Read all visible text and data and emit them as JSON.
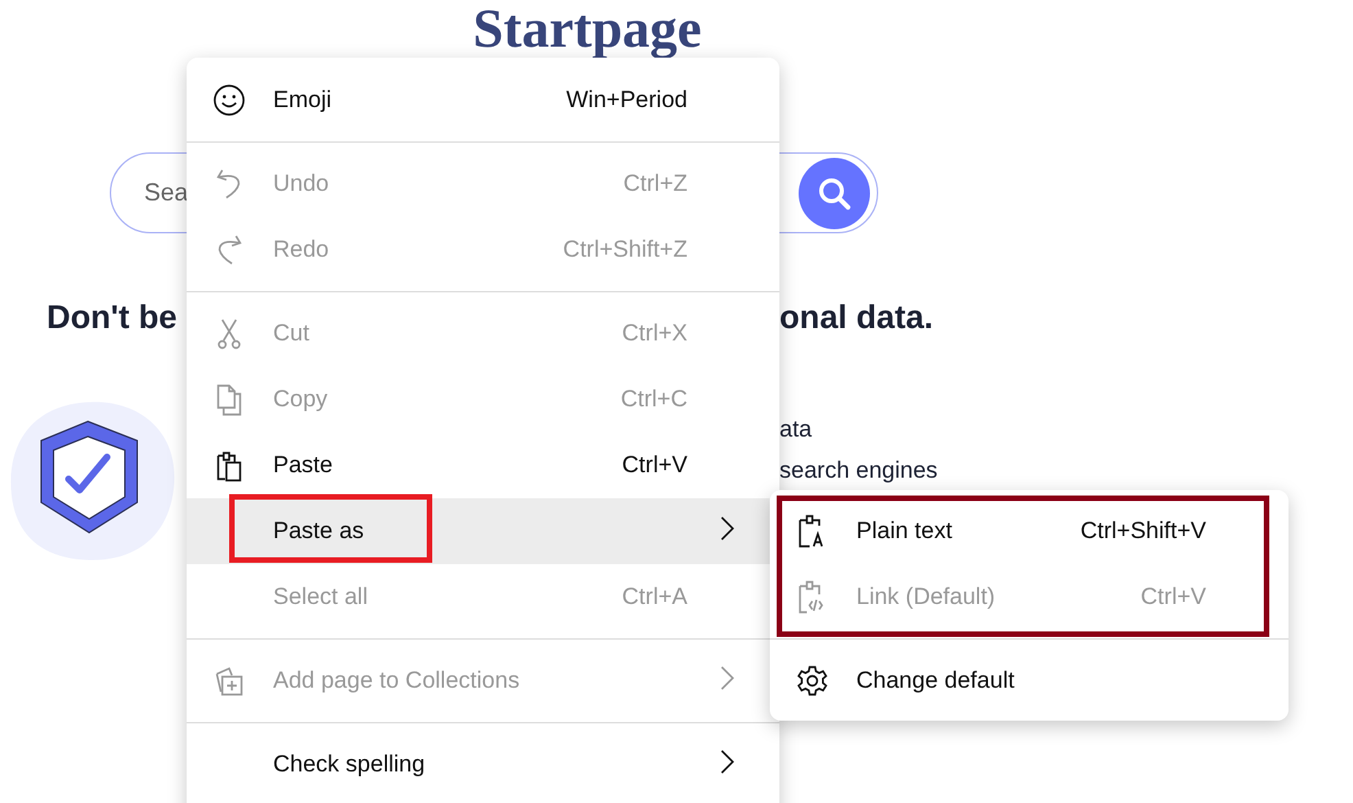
{
  "page": {
    "logo": "Startpage",
    "search": {
      "placeholder": "Sea"
    },
    "headline": [
      "Don't be",
      "onal data."
    ],
    "features": [
      "ata",
      "search engines"
    ]
  },
  "context_menu": {
    "items": [
      {
        "kind": "item",
        "label": "Emoji",
        "shortcut": "Win+Period",
        "disabled": false,
        "selected": false,
        "submenu": false
      },
      {
        "kind": "separator"
      },
      {
        "kind": "item",
        "label": "Undo",
        "shortcut": "Ctrl+Z",
        "disabled": true,
        "selected": false,
        "submenu": false
      },
      {
        "kind": "item",
        "label": "Redo",
        "shortcut": "Ctrl+Shift+Z",
        "disabled": true,
        "selected": false,
        "submenu": false
      },
      {
        "kind": "separator"
      },
      {
        "kind": "item",
        "label": "Cut",
        "shortcut": "Ctrl+X",
        "disabled": true,
        "selected": false,
        "submenu": false
      },
      {
        "kind": "item",
        "label": "Copy",
        "shortcut": "Ctrl+C",
        "disabled": true,
        "selected": false,
        "submenu": false
      },
      {
        "kind": "item",
        "label": "Paste",
        "shortcut": "Ctrl+V",
        "disabled": false,
        "selected": false,
        "submenu": false
      },
      {
        "kind": "item",
        "label": "Paste as",
        "disabled": false,
        "selected": true,
        "submenu": true
      },
      {
        "kind": "item",
        "label": "Select all",
        "shortcut": "Ctrl+A",
        "disabled": true,
        "selected": false,
        "submenu": false
      },
      {
        "kind": "separator"
      },
      {
        "kind": "item",
        "label": "Add page to Collections",
        "disabled": true,
        "selected": false,
        "submenu": true
      },
      {
        "kind": "separator"
      },
      {
        "kind": "item",
        "label": "Check spelling",
        "disabled": false,
        "selected": false,
        "submenu": true
      }
    ]
  },
  "submenu": {
    "items": [
      {
        "kind": "item",
        "label": "Plain text",
        "shortcut": "Ctrl+Shift+V",
        "disabled": false
      },
      {
        "kind": "item",
        "label": "Link (Default)",
        "shortcut": "Ctrl+V",
        "disabled": true
      },
      {
        "kind": "separator"
      },
      {
        "kind": "item",
        "label": "Change default",
        "disabled": false
      }
    ]
  },
  "annotations": [
    {
      "kind": "menu-item",
      "color": "#e81c23"
    },
    {
      "kind": "submenu-group",
      "color": "#8b0016"
    }
  ]
}
